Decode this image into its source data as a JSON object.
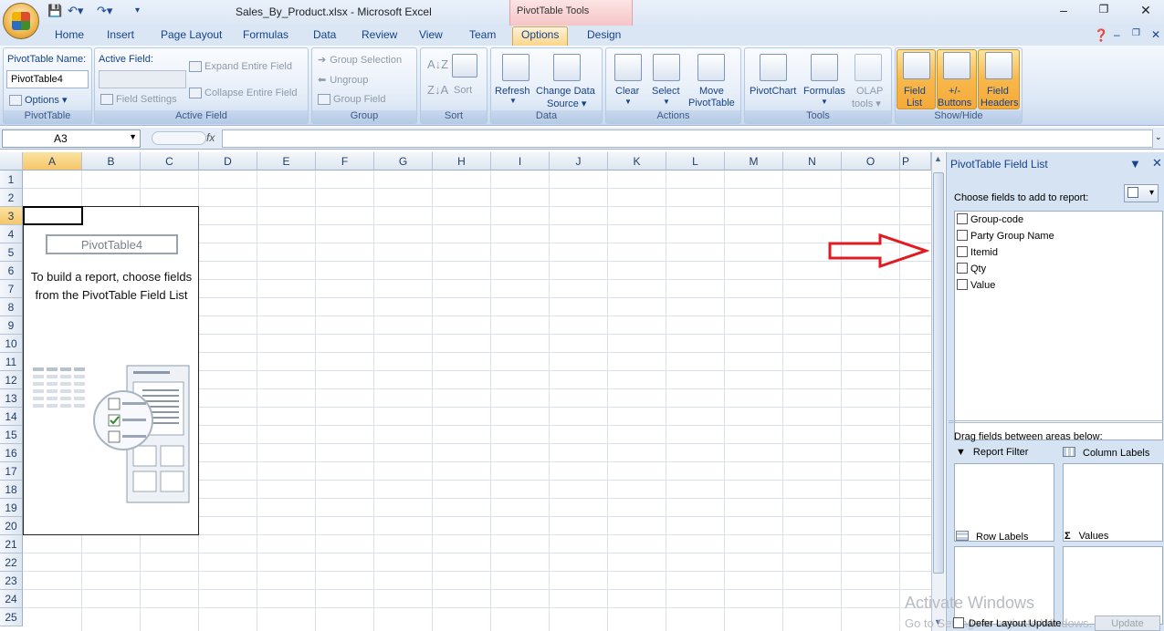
{
  "window": {
    "title": "Sales_By_Product.xlsx - Microsoft Excel",
    "contextual_tab_group": "PivotTable Tools"
  },
  "tabs": [
    "Home",
    "Insert",
    "Page Layout",
    "Formulas",
    "Data",
    "Review",
    "View",
    "Team",
    "Options",
    "Design"
  ],
  "active_tab": "Options",
  "ribbon": {
    "pivottable_group": {
      "label": "PivotTable",
      "name_label": "PivotTable Name:",
      "name_value": "PivotTable4",
      "options": "Options"
    },
    "active_field_group": {
      "label": "Active Field",
      "field_label": "Active Field:",
      "field_settings": "Field Settings",
      "expand": "Expand Entire Field",
      "collapse": "Collapse Entire Field"
    },
    "group_group": {
      "label": "Group",
      "group_selection": "Group Selection",
      "ungroup": "Ungroup",
      "group_field": "Group Field"
    },
    "sort_group": {
      "label": "Sort",
      "sort": "Sort"
    },
    "data_group": {
      "label": "Data",
      "refresh": "Refresh",
      "change_source_1": "Change Data",
      "change_source_2": "Source"
    },
    "actions_group": {
      "label": "Actions",
      "clear": "Clear",
      "select": "Select",
      "move_1": "Move",
      "move_2": "PivotTable"
    },
    "tools_group": {
      "label": "Tools",
      "pivotchart": "PivotChart",
      "formulas": "Formulas",
      "olap_1": "OLAP",
      "olap_2": "tools"
    },
    "showhide_group": {
      "label": "Show/Hide",
      "field_list_1": "Field",
      "field_list_2": "List",
      "buttons_1": "+/-",
      "buttons_2": "Buttons",
      "headers_1": "Field",
      "headers_2": "Headers"
    }
  },
  "formula_bar": {
    "name_box": "A3",
    "fx": "fx",
    "value": ""
  },
  "columns": [
    "A",
    "B",
    "C",
    "D",
    "E",
    "F",
    "G",
    "H",
    "I",
    "J",
    "K",
    "L",
    "M",
    "N",
    "O",
    "P"
  ],
  "rows": [
    "1",
    "2",
    "3",
    "4",
    "5",
    "6",
    "7",
    "8",
    "9",
    "10",
    "11",
    "12",
    "13",
    "14",
    "15",
    "16",
    "17",
    "18",
    "19",
    "20",
    "21",
    "22",
    "23",
    "24",
    "25"
  ],
  "pivot_placeholder": {
    "name": "PivotTable4",
    "instruction": "To build a report, choose fields from the PivotTable Field List"
  },
  "field_list": {
    "title": "PivotTable Field List",
    "choose_label": "Choose fields to add to report:",
    "fields": [
      "Group-code",
      "Party Group Name",
      "Itemid",
      "Qty",
      "Value"
    ],
    "drag_label": "Drag fields between areas below:",
    "areas": {
      "report_filter": "Report Filter",
      "column_labels": "Column Labels",
      "row_labels": "Row Labels",
      "values": "Values"
    },
    "defer": "Defer Layout Update",
    "update": "Update"
  },
  "watermark": {
    "line1": "Activate Windows",
    "line2": "Go to Settings to activate Windows."
  }
}
